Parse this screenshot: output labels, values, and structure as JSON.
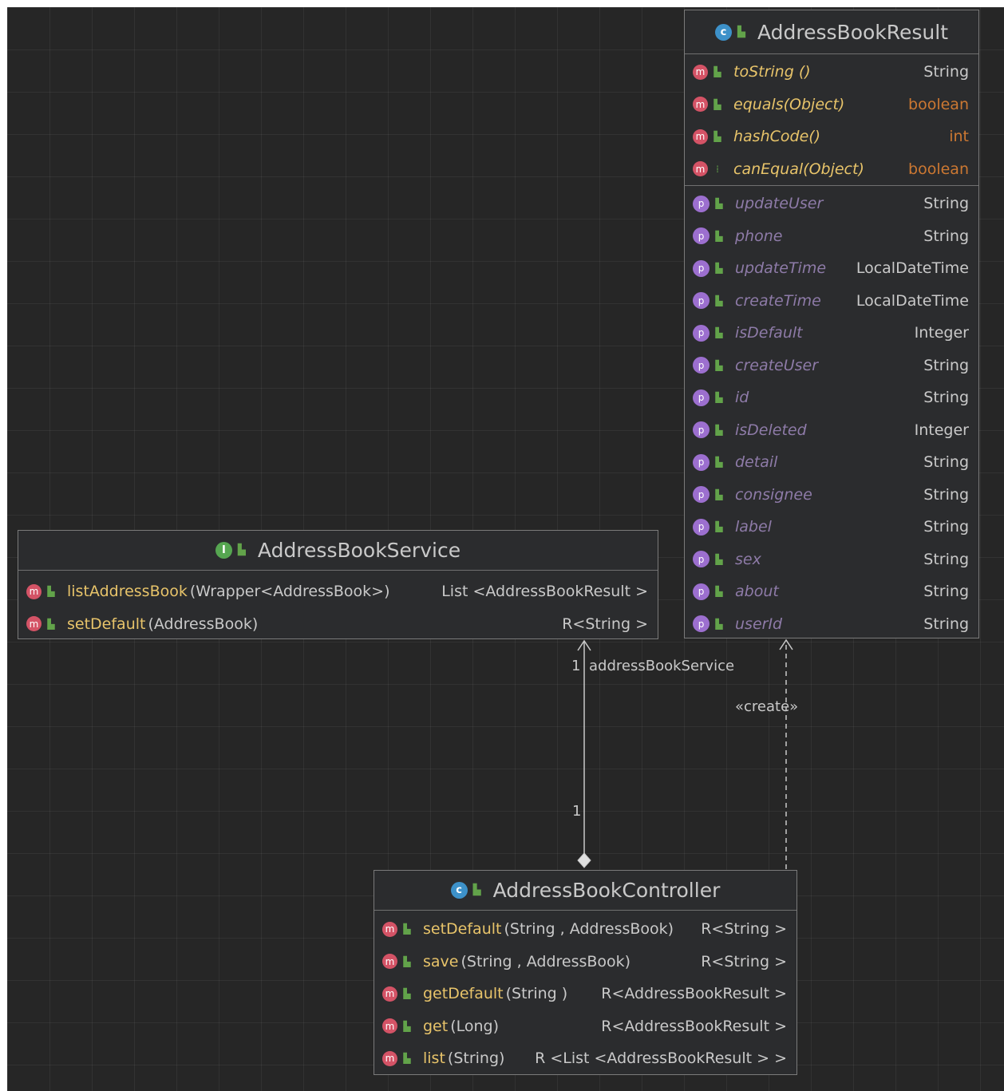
{
  "colors": {
    "canvas": "#262626",
    "box_fill": "#2b2c2e",
    "method_icon": "#d45366",
    "property_icon": "#9c6fcf",
    "class_icon": "#3d91c9",
    "interface_icon": "#56a651",
    "method_name": "#e8c46a",
    "keyword_type": "#cc7832"
  },
  "result_class": {
    "title": "AddressBookResult",
    "kind_icon": "class-icon",
    "kind_letter": "c",
    "methods": [
      {
        "name": "toString ()",
        "ret": "String",
        "keyword": false
      },
      {
        "name": "equals(Object)",
        "ret": "boolean",
        "keyword": true
      },
      {
        "name": "hashCode()",
        "ret": "int",
        "keyword": true
      },
      {
        "name": "canEqual(Object)",
        "ret": "boolean",
        "keyword": true
      }
    ],
    "properties": [
      {
        "name": "updateUser",
        "type": "String"
      },
      {
        "name": "phone",
        "type": "String"
      },
      {
        "name": "updateTime",
        "type": "LocalDateTime"
      },
      {
        "name": "createTime",
        "type": "LocalDateTime"
      },
      {
        "name": "isDefault",
        "type": "Integer"
      },
      {
        "name": "createUser",
        "type": "String"
      },
      {
        "name": "id",
        "type": "String"
      },
      {
        "name": "isDeleted",
        "type": "Integer"
      },
      {
        "name": "detail",
        "type": "String"
      },
      {
        "name": "consignee",
        "type": "String"
      },
      {
        "name": "label",
        "type": "String"
      },
      {
        "name": "sex",
        "type": "String"
      },
      {
        "name": "about",
        "type": "String"
      },
      {
        "name": "userId",
        "type": "String"
      }
    ]
  },
  "service_interface": {
    "title": "AddressBookService",
    "kind_icon": "interface-icon",
    "kind_letter": "I",
    "methods": [
      {
        "name": "listAddressBook",
        "params": "(Wrapper<AddressBook>)",
        "ret": "List <AddressBookResult >"
      },
      {
        "name": "setDefault",
        "params": "(AddressBook)",
        "ret": "R<String >"
      }
    ]
  },
  "controller_class": {
    "title": "AddressBookController",
    "kind_icon": "class-icon",
    "kind_letter": "c",
    "methods": [
      {
        "name": "setDefault",
        "params": "(String , AddressBook)",
        "ret": "R<String >"
      },
      {
        "name": "save",
        "params": "(String , AddressBook)",
        "ret": "R<String >"
      },
      {
        "name": "getDefault",
        "params": "(String )",
        "ret": "R<AddressBookResult >"
      },
      {
        "name": "get",
        "params": "(Long)",
        "ret": "R<AddressBookResult >"
      },
      {
        "name": "list",
        "params": "(String)",
        "ret": "R <List <AddressBookResult > >"
      }
    ]
  },
  "connectors": {
    "association": {
      "role": "addressBookService",
      "mult_top": "1",
      "mult_bottom": "1",
      "style": "composition-diamond-to-arrow"
    },
    "dependency": {
      "stereotype": "«create»",
      "style": "dashed-arrow"
    }
  },
  "icon_names": {
    "method": "m",
    "property": "p",
    "public": "public-icon",
    "package_private": "package-icon"
  }
}
